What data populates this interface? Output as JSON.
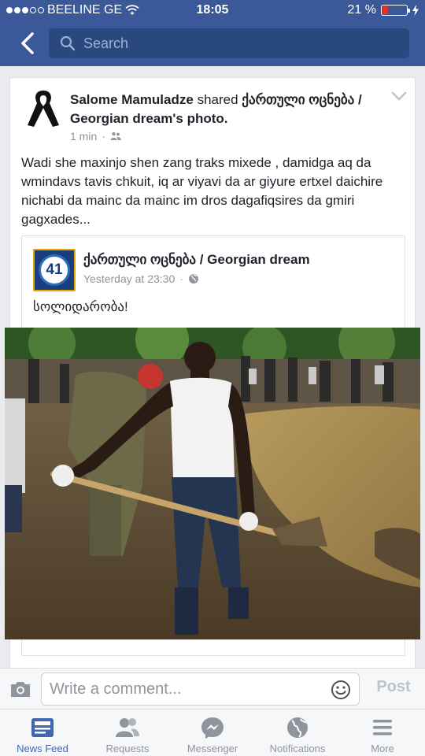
{
  "status_bar": {
    "carrier": "BEELINE GE",
    "time": "18:05",
    "battery_percent": "21 %",
    "battery_level": 0.21
  },
  "navbar": {
    "search_placeholder": "Search"
  },
  "post": {
    "author": "Salome Mamuladze",
    "action": "shared",
    "source_page": "ქართული ოცნება / Georgian dream",
    "source_suffix": "'s photo.",
    "time": "1 min",
    "body": "Wadi she maxinjo shen zang traks mixede , damidga aq da wmindavs  tavis chkuit, iq ar viyavi da ar giyure ertxel daichire nichabi da mainc da mainc im dros dagafiqsires da gmiri gagxades...",
    "shared": {
      "page_logo_number": "41",
      "page_name": "ქართული ოცნება / Georgian dream",
      "time": "Yesterday at 23:30",
      "text": "სოლიდარობა!"
    }
  },
  "comment_bar": {
    "placeholder": "Write a comment...",
    "post_label": "Post"
  },
  "tabs": [
    {
      "label": "News Feed",
      "icon": "news-feed-icon",
      "active": true
    },
    {
      "label": "Requests",
      "icon": "friend-requests-icon",
      "active": false
    },
    {
      "label": "Messenger",
      "icon": "messenger-icon",
      "active": false
    },
    {
      "label": "Notifications",
      "icon": "globe-icon",
      "active": false
    },
    {
      "label": "More",
      "icon": "menu-icon",
      "active": false
    }
  ],
  "colors": {
    "brand_blue": "#3b5998",
    "search_bg": "#29487d",
    "active_tab": "#4267b2",
    "battery_low": "#e4312a"
  }
}
